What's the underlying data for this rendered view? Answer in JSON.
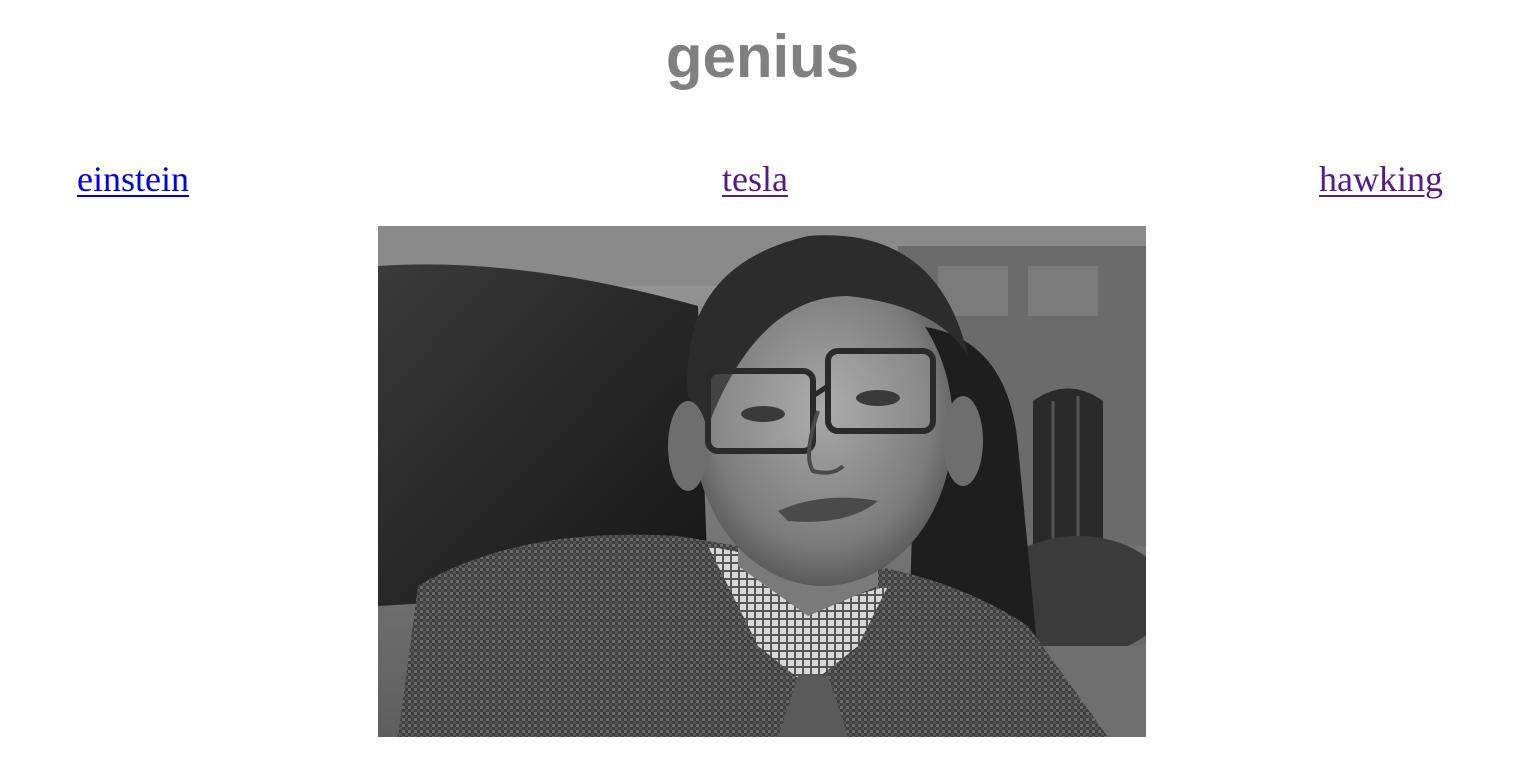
{
  "page": {
    "title": "genius"
  },
  "nav": {
    "links": [
      {
        "label": "einstein",
        "visited": false
      },
      {
        "label": "tesla",
        "visited": true
      },
      {
        "label": "hawking",
        "visited": true
      }
    ]
  },
  "colors": {
    "title": "#808080",
    "link_unvisited": "#0000ee",
    "link_visited": "#551a8b"
  },
  "photo": {
    "subject": "hawking",
    "style": "black-and-white portrait photograph"
  }
}
